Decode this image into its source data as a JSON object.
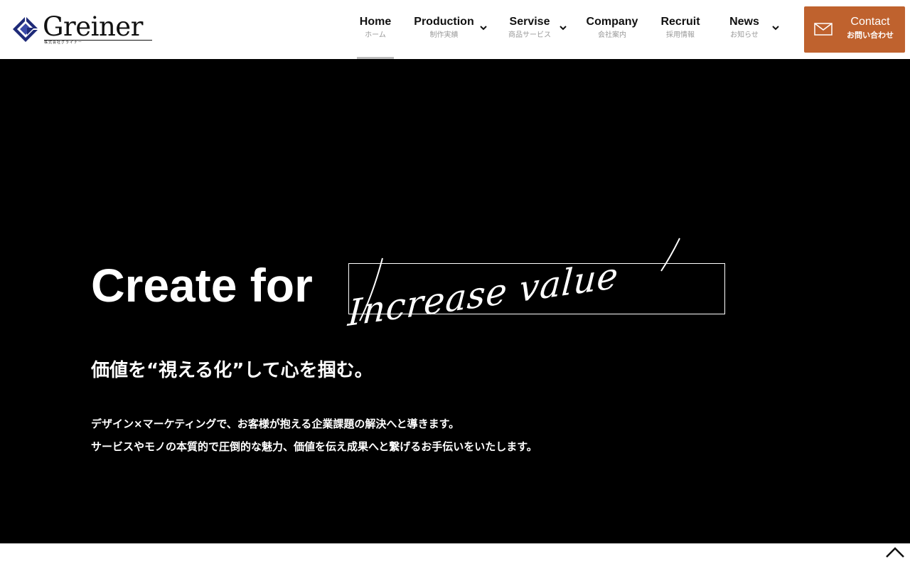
{
  "brand": {
    "name": "Greiner",
    "tagline": "株式会社グライナー",
    "colors": {
      "accent": "#bf622e",
      "logo_blue": "#1e2a78",
      "hero_bg": "#000000"
    }
  },
  "nav": {
    "items": [
      {
        "en": "Home",
        "ja": "ホーム",
        "active": true,
        "dropdown": false
      },
      {
        "en": "Production",
        "ja": "制作実績",
        "active": false,
        "dropdown": true
      },
      {
        "en": "Servise",
        "ja": "商品サービス",
        "active": false,
        "dropdown": true
      },
      {
        "en": "Company",
        "ja": "会社案内",
        "active": false,
        "dropdown": false
      },
      {
        "en": "Recruit",
        "ja": "採用情報",
        "active": false,
        "dropdown": false
      },
      {
        "en": "News",
        "ja": "お知らせ",
        "active": false,
        "dropdown": true
      }
    ],
    "contact": {
      "en": "Contact",
      "ja": "お問い合わせ",
      "icon": "mail-icon"
    }
  },
  "hero": {
    "title_prefix": "Create for",
    "title_script": "Increase value",
    "subtitle": "価値を“視える化”して心を掴む。",
    "body": [
      "デザイン×マーケティングで、お客様が抱える企業課題の解決へと導きます。",
      "サービスやモノの本質的で圧倒的な魅力、価値を伝え成果へと繋げるお手伝いをいたします。"
    ]
  },
  "icons": {
    "dropdown": "chevron-down-icon",
    "back_to_top": "chevron-up-icon"
  }
}
